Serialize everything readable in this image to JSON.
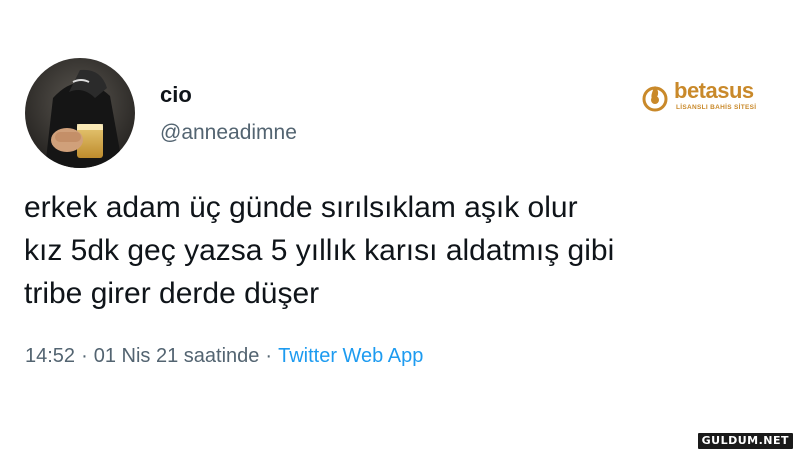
{
  "author": {
    "display_name": "cio",
    "handle": "@anneadimne",
    "avatar_icon": "profile-photo"
  },
  "sponsor": {
    "name": "betasus",
    "tagline": "LİSANSLI BAHİS SİTESİ",
    "color": "#c9892a",
    "icon": "flame-icon"
  },
  "tweet": {
    "lines": [
      "erkek adam üç günde sırılsıklam aşık olur",
      "kız 5dk geç yazsa 5 yıllık karısı aldatmış gibi",
      "tribe girer derde düşer"
    ]
  },
  "meta": {
    "time": "14:52",
    "separator": "·",
    "date": "01 Nis 21 saatinde",
    "source": "Twitter Web App"
  },
  "watermark": {
    "text": "GULDUM.NET"
  },
  "colors": {
    "text": "#0f1419",
    "muted": "#536471",
    "link": "#1d9bf0"
  }
}
